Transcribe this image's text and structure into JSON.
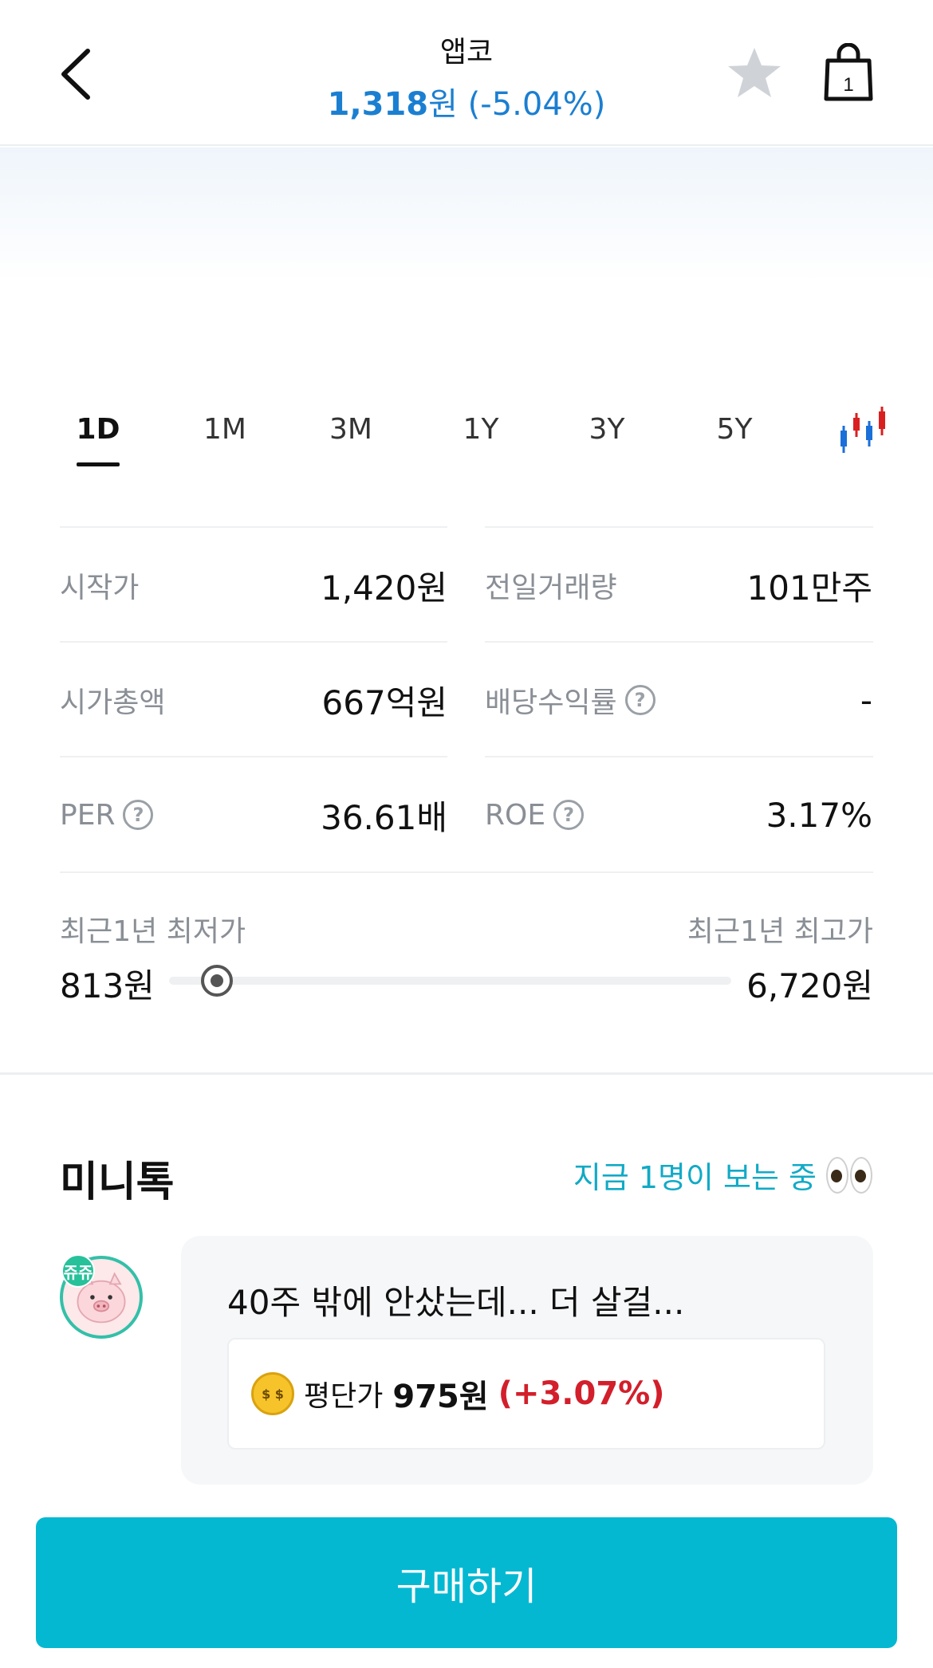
{
  "header": {
    "stock_name": "앱코",
    "price": "1,318",
    "price_unit": "원",
    "change": "(-5.04%)",
    "cart_count": "1",
    "icons": [
      "back-chevron-icon",
      "star-icon",
      "shopping-bag-icon"
    ]
  },
  "tabs": {
    "items": [
      "1D",
      "1M",
      "3M",
      "1Y",
      "3Y",
      "5Y"
    ],
    "active": "1D",
    "chart_mode_icon": "candlestick-icon"
  },
  "stats": {
    "open_label": "시작가",
    "open_value": "1,420원",
    "prev_volume_label": "전일거래량",
    "prev_volume_value": "101만주",
    "market_cap_label": "시가총액",
    "market_cap_value": "667억원",
    "dividend_label": "배당수익률",
    "dividend_value": "-",
    "per_label": "PER",
    "per_value": "36.61배",
    "roe_label": "ROE",
    "roe_value": "3.17%",
    "help_glyph": "?"
  },
  "range": {
    "low_label": "최근1년 최저가",
    "low_value": "813원",
    "high_label": "최근1년 최고가",
    "high_value": "6,720원",
    "current_fraction": 0.085
  },
  "minitalk": {
    "title": "미니톡",
    "viewers": "지금 1명이 보는 중",
    "badge": "쥬쥬",
    "message": "40주 밖에 안샀는데... 더 살걸...",
    "avg_label": "평단가",
    "avg_value": "975원",
    "avg_change": "(+3.07%)",
    "coin_glyph": "$ $"
  },
  "buy_button": "구매하기",
  "colors": {
    "accent": "#04b8d2",
    "price_blue": "#1b7fd1",
    "up_red": "#d21f2b",
    "viewer_teal": "#11aac6"
  }
}
